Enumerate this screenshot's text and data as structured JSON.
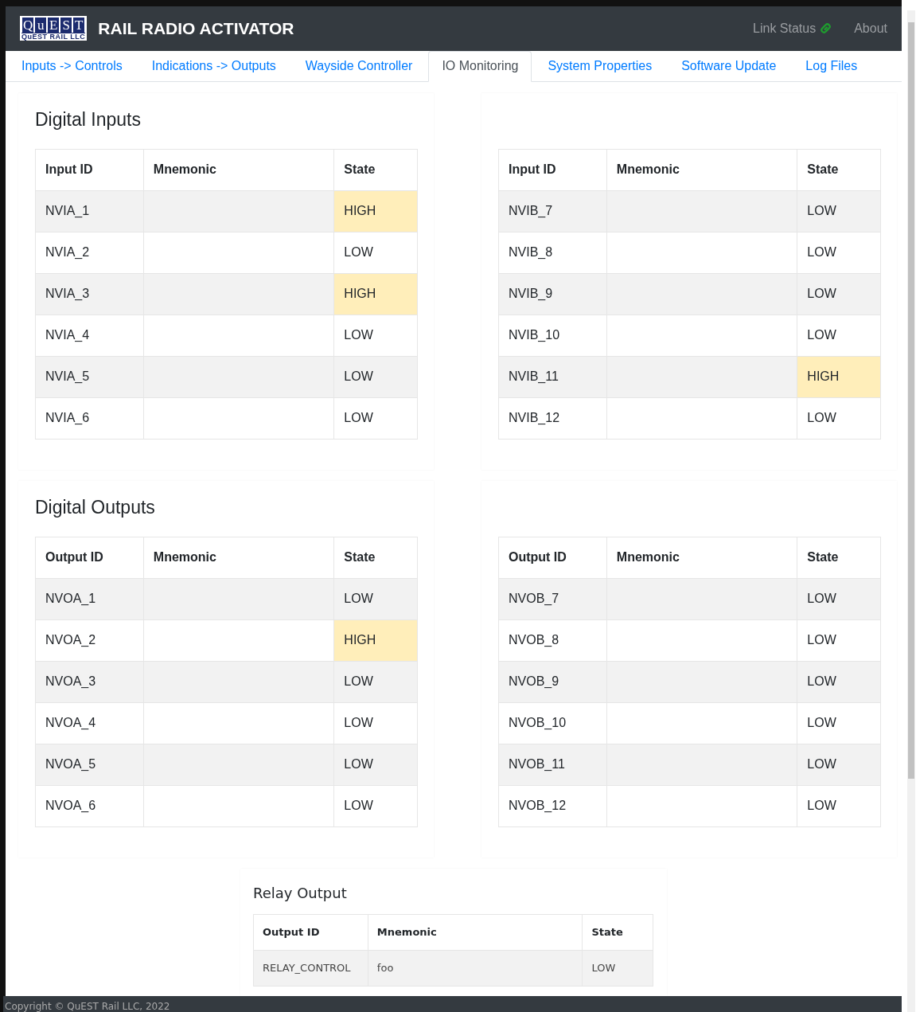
{
  "header": {
    "logo": {
      "letters": [
        "Q",
        "u",
        "E",
        "S",
        "T"
      ],
      "subtitle": "QuEST RAIL LLC"
    },
    "title": "RAIL RADIO ACTIVATOR",
    "links": [
      {
        "label": "Link Status",
        "kind": "status"
      },
      {
        "label": "About",
        "kind": "plain"
      }
    ]
  },
  "tabs": [
    {
      "label": "Inputs -> Controls",
      "selected": false
    },
    {
      "label": "Indications -> Outputs",
      "selected": false
    },
    {
      "label": "Wayside Controller",
      "selected": false
    },
    {
      "label": "IO Monitoring",
      "selected": true
    },
    {
      "label": "System Properties",
      "selected": false
    },
    {
      "label": "Software Update",
      "selected": false
    },
    {
      "label": "Log Files",
      "selected": false
    }
  ],
  "sections": [
    {
      "title": "Digital Inputs",
      "tables": [
        {
          "columns": [
            "Input ID",
            "Mnemonic",
            "State"
          ],
          "rows": [
            {
              "id": "NVIA_1",
              "state": "HIGH",
              "active": true
            },
            {
              "id": "NVIA_2",
              "state": "LOW",
              "active": false
            },
            {
              "id": "NVIA_3",
              "state": "HIGH",
              "active": true
            },
            {
              "id": "NVIA_4",
              "state": "LOW",
              "active": false
            },
            {
              "id": "NVIA_5",
              "state": "LOW",
              "active": false
            },
            {
              "id": "NVIA_6",
              "state": "LOW",
              "active": false
            }
          ]
        },
        {
          "columns": [
            "Input ID",
            "Mnemonic",
            "State"
          ],
          "rows": [
            {
              "id": "NVIB_7",
              "state": "LOW",
              "active": false
            },
            {
              "id": "NVIB_8",
              "state": "LOW",
              "active": false
            },
            {
              "id": "NVIB_9",
              "state": "LOW",
              "active": false
            },
            {
              "id": "NVIB_10",
              "state": "LOW",
              "active": false
            },
            {
              "id": "NVIB_11",
              "state": "HIGH",
              "active": true
            },
            {
              "id": "NVIB_12",
              "state": "LOW",
              "active": false
            }
          ]
        }
      ]
    },
    {
      "title": "Digital Outputs",
      "tables": [
        {
          "columns": [
            "Output ID",
            "Mnemonic",
            "State"
          ],
          "rows": [
            {
              "id": "NVOA_1",
              "state": "LOW",
              "active": false
            },
            {
              "id": "NVOA_2",
              "state": "HIGH",
              "active": true
            },
            {
              "id": "NVOA_3",
              "state": "LOW",
              "active": false
            },
            {
              "id": "NVOA_4",
              "state": "LOW",
              "active": false
            },
            {
              "id": "NVOA_5",
              "state": "LOW",
              "active": false
            },
            {
              "id": "NVOA_6",
              "state": "LOW",
              "active": false
            }
          ]
        },
        {
          "columns": [
            "Output ID",
            "Mnemonic",
            "State"
          ],
          "rows": [
            {
              "id": "NVOB_7",
              "state": "LOW",
              "active": false
            },
            {
              "id": "NVOB_8",
              "state": "LOW",
              "active": false
            },
            {
              "id": "NVOB_9",
              "state": "LOW",
              "active": false
            },
            {
              "id": "NVOB_10",
              "state": "LOW",
              "active": false
            },
            {
              "id": "NVOB_11",
              "state": "LOW",
              "active": false
            },
            {
              "id": "NVOB_12",
              "state": "LOW",
              "active": false
            }
          ]
        }
      ]
    }
  ],
  "relay": {
    "title": "Relay Output",
    "columns": [
      "Output ID",
      "Mnemonic",
      "State"
    ],
    "rows": [
      {
        "id": "RELAY_CONTROL",
        "mnemonic": "foo",
        "state": "LOW",
        "active": false
      }
    ]
  },
  "footer": "Copyright © QuEST Rail LLC, 2022"
}
